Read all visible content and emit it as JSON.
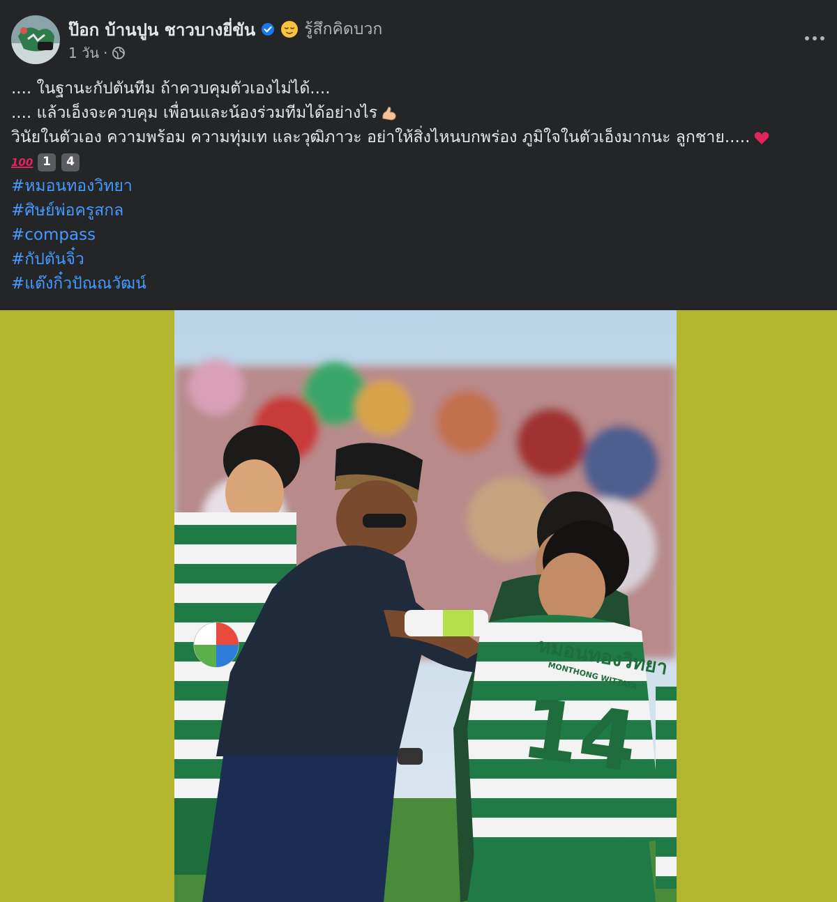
{
  "post": {
    "author": "ป๊อก บ้านปูน ชาวบางยี่ขัน",
    "feeling": "รู้สึกคิดบวก",
    "time": "1 วัน",
    "separator": "·",
    "lines": [
      ".... ในฐานะกัปตันทีม ถ้าควบคุมตัวเองไม่ได้....",
      ".... แล้วเอ็งจะควบคุม เพื่อนและน้องร่วมทีมได้อย่างไร",
      "วินัยในตัวเอง ความพร้อม ความทุ่มเท และวุฒิภาวะ อย่าให้สิ่งไหนบกพร่อง ภูมิใจในตัวเอ็งมากนะ ลูกชาย....."
    ],
    "number_keys": [
      "1",
      "4"
    ],
    "hashtags": [
      "#หมอนทองวิทยา",
      "#ศิษย์พ่อครูสกล",
      "#compass",
      "#กัปตันจิ๋ว",
      "#แต๊งกิ๋วปัณณวัฒน์"
    ]
  },
  "photo": {
    "jersey_sponsor": "หมอนทองวิทยา",
    "jersey_subtitle": "MONTHONG WITTAYA",
    "jersey_number": "14"
  },
  "icons": {
    "verified": "verified-badge-icon",
    "feeling": "relieved-face-icon",
    "privacy": "globe-icon",
    "more": "more-options-icon",
    "muscle": "flexed-biceps-icon",
    "heart": "red-heart-icon",
    "hundred": "hundred-points-icon"
  },
  "colors": {
    "background": "#242526",
    "text": "#e4e6eb",
    "secondary_text": "#b0b3b8",
    "hashtag": "#4599ff",
    "verified": "#1877f2",
    "media_letterbox": "#b3b52e"
  }
}
